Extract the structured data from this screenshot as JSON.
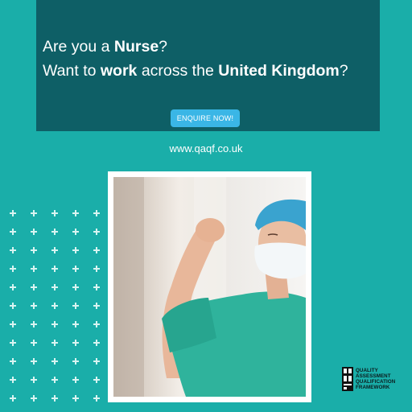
{
  "headline": {
    "line1": [
      {
        "text": "Are you a ",
        "bold": false
      },
      {
        "text": "Nurse",
        "bold": true
      },
      {
        "text": "?",
        "bold": false
      }
    ],
    "line2": [
      {
        "text": "Want to ",
        "bold": false
      },
      {
        "text": "work",
        "bold": true
      },
      {
        "text": " across the ",
        "bold": false
      },
      {
        "text": "United Kingdom",
        "bold": true
      },
      {
        "text": "?",
        "bold": false
      }
    ]
  },
  "cta": {
    "label": "ENQUIRE NOW!"
  },
  "website": "www.qaqf.co.uk",
  "logo": {
    "lines": [
      "QUALITY",
      "ASSESSMENT",
      "QUALIFICATION",
      "FRAMEWORK"
    ]
  },
  "photo": {
    "subject": "nurse-flexing-arm-photo"
  },
  "colors": {
    "background": "#1aaea9",
    "banner": "#0e5f66",
    "button": "#3ab6e6",
    "text": "#ffffff"
  }
}
